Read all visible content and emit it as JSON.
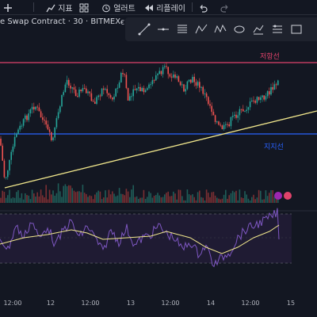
{
  "toolbar": {
    "add_label": "",
    "indicators_label": "지표",
    "alerts_label": "얼러트",
    "replay_label": "리플레이"
  },
  "symbol": {
    "title": "e Swap Contract · 30 · BITMEX",
    "extra": "€"
  },
  "levels": {
    "resistance_label": "저항선",
    "support_label": "지지선",
    "resistance_color": "#e0436b",
    "support_color": "#2962ff",
    "trendline_color": "#f0e68c"
  },
  "time_axis": {
    "ticks": [
      "12:00",
      "12",
      "12:00",
      "13",
      "12:00",
      "14",
      "12:00",
      "15"
    ]
  },
  "drawing_tools": [
    "cursor-icon",
    "trendline-icon",
    "horizontal-line-icon",
    "fib-icon",
    "pattern-icon",
    "zigzag-icon",
    "ellipse-icon",
    "measure-icon",
    "brush-icon",
    "rectangle-icon"
  ],
  "rsi": {
    "band_color": "#7e57c2",
    "line_color": "#7e57c2",
    "ma_color": "#f0e68c"
  }
}
